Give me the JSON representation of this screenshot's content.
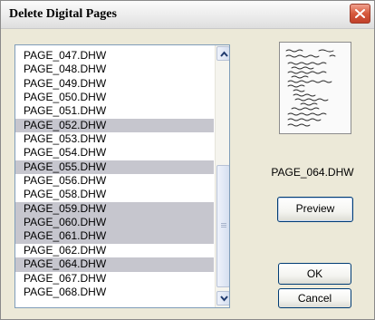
{
  "window": {
    "title": "Delete Digital Pages",
    "close_icon": "close-icon"
  },
  "list": {
    "items": [
      {
        "label": "PAGE_047.DHW",
        "selected": false
      },
      {
        "label": "PAGE_048.DHW",
        "selected": false
      },
      {
        "label": "PAGE_049.DHW",
        "selected": false
      },
      {
        "label": "PAGE_050.DHW",
        "selected": false
      },
      {
        "label": "PAGE_051.DHW",
        "selected": false
      },
      {
        "label": "PAGE_052.DHW",
        "selected": true
      },
      {
        "label": "PAGE_053.DHW",
        "selected": false
      },
      {
        "label": "PAGE_054.DHW",
        "selected": false
      },
      {
        "label": "PAGE_055.DHW",
        "selected": true
      },
      {
        "label": "PAGE_056.DHW",
        "selected": false
      },
      {
        "label": "PAGE_058.DHW",
        "selected": false
      },
      {
        "label": "PAGE_059.DHW",
        "selected": true
      },
      {
        "label": "PAGE_060.DHW",
        "selected": true
      },
      {
        "label": "PAGE_061.DHW",
        "selected": true
      },
      {
        "label": "PAGE_062.DHW",
        "selected": false
      },
      {
        "label": "PAGE_064.DHW",
        "selected": true
      },
      {
        "label": "PAGE_067.DHW",
        "selected": false
      },
      {
        "label": "PAGE_068.DHW",
        "selected": false
      }
    ],
    "selection_color": "#c6c6ce"
  },
  "preview": {
    "current_page": "PAGE_064.DHW",
    "button_label": "Preview"
  },
  "buttons": {
    "ok_label": "OK",
    "cancel_label": "Cancel"
  },
  "colors": {
    "dialog_background": "#ece9d8",
    "close_button": "#d6593c",
    "list_border": "#7f9db9"
  }
}
